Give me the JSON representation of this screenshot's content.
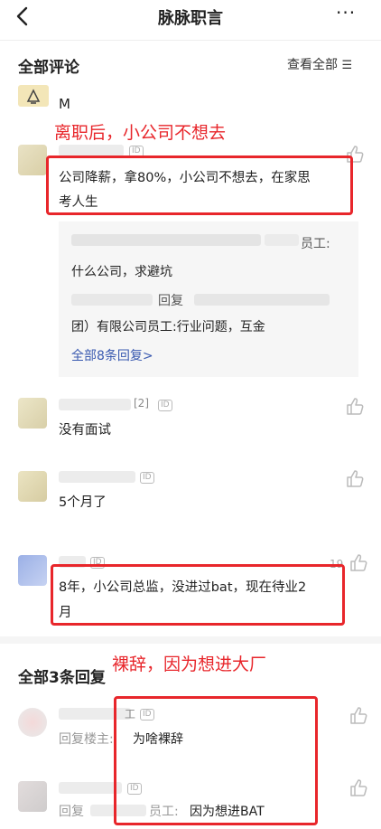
{
  "header": {
    "title": "脉脉职言"
  },
  "comments_section": {
    "title": "全部评论",
    "view_all": "查看全部"
  },
  "annotations": {
    "first": "离职后，小公司不想去",
    "second": "裸辞，因为想进大厂"
  },
  "comments": [
    {
      "text": "M"
    },
    {
      "text_line1": "公司降薪，拿80%，小公司不想去，在家思",
      "text_line2": "考人生",
      "replies": {
        "line1_tail": "员工:",
        "line2": "什么公司，求避坑",
        "line3_mid": "回复",
        "line4": "团）有限公司员工:行业问题，互金",
        "more": "全部8条回复>"
      }
    },
    {
      "name_suffix": "[2]",
      "text": "没有面试"
    },
    {
      "text": "5个月了"
    },
    {
      "badge": "19",
      "text_line1": "8年，小公司总监，没进过bat，现在待业2",
      "text_line2": "月"
    }
  ],
  "replies_section": {
    "title": "全部3条回复"
  },
  "replies": [
    {
      "name_suffix": "工",
      "prefix": "回复楼主:",
      "text": "为啥裸辞"
    },
    {
      "prefix": "回复",
      "name_suffix": "员工:",
      "text": "因为想进BAT"
    }
  ],
  "labels": {
    "id": "ID"
  }
}
